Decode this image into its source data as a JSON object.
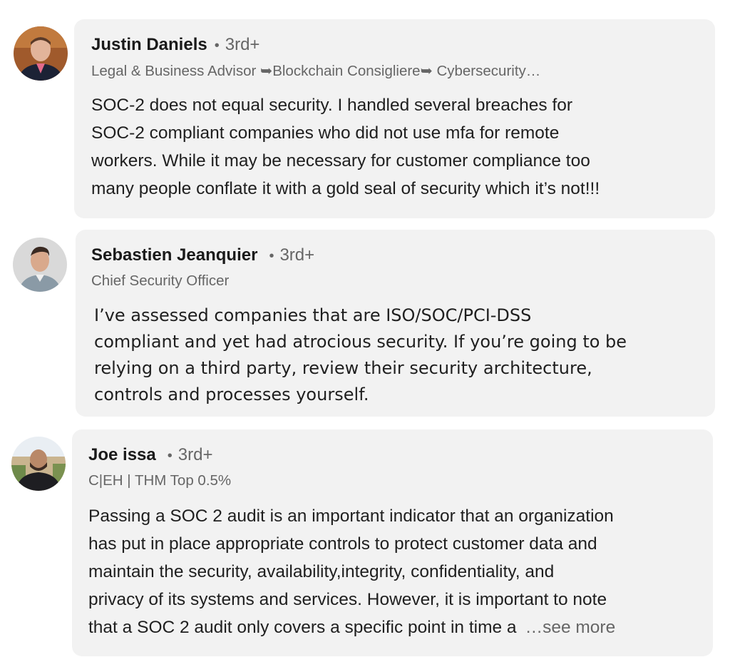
{
  "comments": [
    {
      "author": "Justin Daniels",
      "separator": "•",
      "degree": "3rd+",
      "headline": "Legal & Business Advisor ➥Blockchain Consigliere➥ Cybersecurity…",
      "lines": [
        "SOC-2 does not equal security. I handled several breaches for",
        "SOC-2 compliant companies who did not use mfa for remote",
        "workers. While it may be necessary for customer compliance too",
        "many people conflate it with a gold seal of security which it’s not!!!"
      ]
    },
    {
      "author": "Sebastien Jeanquier",
      "separator": "•",
      "degree": "3rd+",
      "headline": "Chief Security Officer",
      "lines": [
        "I’ve assessed companies that are ISO/SOC/PCI-DSS",
        "compliant and yet had atrocious security. If you’re going to be",
        "relying on a third party, review their security architecture,",
        "controls and processes yourself."
      ]
    },
    {
      "author": "Joe issa",
      "separator": "•",
      "degree": "3rd+",
      "headline": "C|EH | THM Top 0.5%",
      "lines": [
        "Passing a SOC 2 audit is an important indicator that an organization",
        "has put in place appropriate controls to protect customer data and",
        "maintain the security, availability,integrity, confidentiality, and",
        "privacy of its systems and services. However, it is important to note"
      ],
      "truncated_line": "that a SOC 2 audit only covers a specific point in time a",
      "see_more": "…see more"
    }
  ],
  "colors": {
    "card_bg": "#f2f2f2",
    "muted_text": "#666666",
    "primary_text": "#1f1f1f"
  }
}
